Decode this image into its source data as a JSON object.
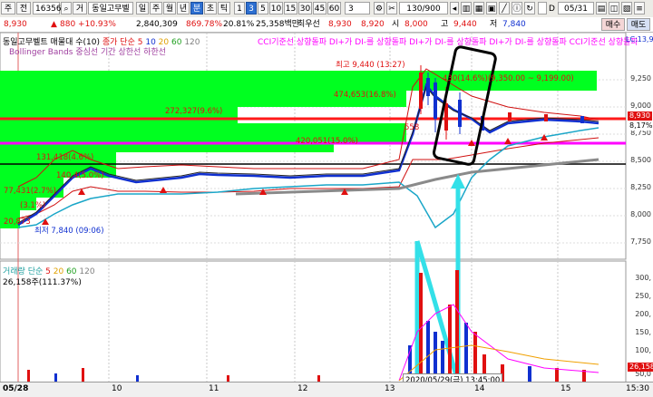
{
  "toolbar": {
    "market_select": "주",
    "period_select": "전",
    "stock_code": "163560",
    "market_code": "거",
    "stock_name": "동일고무벨",
    "period_buttons": [
      "일",
      "주",
      "월",
      "년",
      "분",
      "초",
      "틱"
    ],
    "minute_buttons": [
      "1",
      "3",
      "5",
      "10",
      "15",
      "30",
      "45",
      "60"
    ],
    "interval_value": "3",
    "count_value": "130/900",
    "check_label": "D",
    "date_value": "05/31"
  },
  "quote": {
    "price": "8,930",
    "change": "880 +10.93%",
    "volume": "2,840,309",
    "volume_ratio": "869.78%",
    "turnover_rate": "20.81%",
    "amount": "25,358백만",
    "priority_label": "최우선",
    "ask": "8,930",
    "bid": "8,920",
    "open_label": "시",
    "open": "8,000",
    "high_label": "고",
    "high": "9,440",
    "low_label": "저",
    "low": "7,840",
    "buy_button": "매수",
    "sell_button": "매도"
  },
  "price_panel": {
    "title": "동일고무벨트 매물대 수(10)",
    "ma_label": "종가 단순",
    "ma_periods": [
      "5",
      "10",
      "20",
      "60",
      "120"
    ],
    "signals": [
      "CCI기준선 상향돌파",
      "DI+가 DI-를 상향돌파",
      "DI+가 DI-를 상향돌파",
      "DI+가 DI-를 상향돌파",
      "CCI기준선 상향돌파"
    ],
    "lc_label": "LC:13,9",
    "bollinger_label": "Bollinger Bands 중심선 기간 상한선 하한선",
    "high_mark": "최고 9,440 (13:27)",
    "low_mark": "최저 7,840 (09:06)",
    "volume_profile": [
      {
        "text": "430(14.6%)(9,350.00 ~ 9,199.00)"
      },
      {
        "text": "474,653(16.8%)"
      },
      {
        "text": "272,327(9.6%)"
      },
      {
        "text": "558"
      },
      {
        "text": "420,051(15.0%)"
      },
      {
        "text": "131,418(4.6%)"
      },
      {
        "text": "140,4(5.0%)"
      },
      {
        "text": "77,431(2.7%)"
      },
      {
        "text": "(3.1%)"
      },
      {
        "text": "20,873"
      }
    ],
    "y_ticks": [
      "9,250",
      "9,000",
      "8,750",
      "8,500",
      "8,250",
      "8,000",
      "7,750"
    ],
    "current_price_tag": "8,930",
    "ma_value_tag": "8,17%"
  },
  "volume_panel": {
    "title": "거래량 단순",
    "ma_periods": [
      "5",
      "20",
      "60",
      "120"
    ],
    "current_volume": "26,158주(111.37%)",
    "y_ticks": [
      "300,",
      "250,",
      "200,",
      "150,",
      "100,",
      "50,0"
    ],
    "current_tag": "26,158",
    "cursor_label": "2020/05/29(금) 13:45:00"
  },
  "xaxis": {
    "labels": [
      "05/28",
      "10",
      "11",
      "12",
      "13",
      "14",
      "15",
      "15:30"
    ]
  },
  "colors": {
    "up": "#e01010",
    "down": "#1030d0",
    "profile_green": "#00ff20",
    "accent_cyan": "#33e0e8",
    "magenta": "#ff00ff"
  }
}
